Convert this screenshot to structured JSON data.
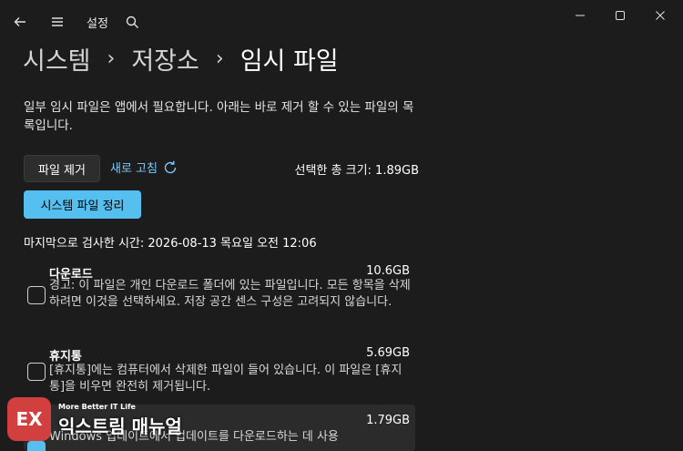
{
  "titlebar": {
    "title": "설정",
    "back_icon": "back-arrow-icon",
    "menu_icon": "hamburger-menu-icon",
    "search_icon": "search-icon"
  },
  "window_controls": [
    "minimize-icon",
    "maximize-icon",
    "close-icon"
  ],
  "breadcrumb": {
    "items": [
      "시스템",
      "저장소"
    ],
    "separator": "›",
    "current": "임시 파일"
  },
  "description": "일부 임시 파일은 앱에서 필요합니다. 아래는 바로 제거 할 수 있는 파일의 목록입니다.",
  "actions": {
    "remove_label": "파일 제거",
    "refresh_label": "새로 고침",
    "total_label": "선택한 총 크기: 1.89GB",
    "cleanup_label": "시스템 파일 정리"
  },
  "last_scan": "마지막으로 검사한 시간: 2026-08-13 목요일 오전 12:06",
  "items": [
    {
      "title": "다운로드",
      "size": "10.6GB",
      "checked": false,
      "desc": "경고: 이 파일은 개인 다운로드 폴더에 있는 파일입니다. 모든 항목을 삭제하려면 이것을 선택하세요. 저장 공간 센스 구성은 고려되지 않습니다."
    },
    {
      "title": "휴지통",
      "size": "5.69GB",
      "checked": false,
      "desc": "[휴지통]에는 컴퓨터에서 삭제한 파일이 들어 있습니다. 이 파일은 [휴지통]을 비우면 완전히 제거됩니다."
    },
    {
      "title": "",
      "size": "1.79GB",
      "checked": true,
      "desc": "Windows 업데이트에서 업데이트를 다운로드하는 데 사용"
    }
  ],
  "watermark": {
    "logo_text": "EX",
    "tagline": "More Better IT Life",
    "name": "익스트림 매뉴얼"
  },
  "colors": {
    "background": "#1c1c1c",
    "accent": "#55bff0",
    "link": "#7fc6f4"
  }
}
